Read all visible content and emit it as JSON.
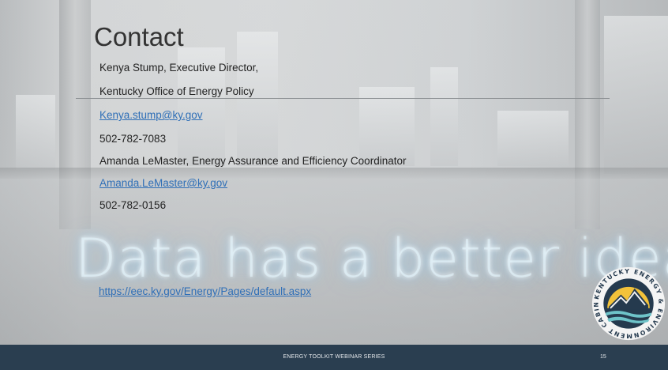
{
  "slide": {
    "title": "Contact",
    "contact_lines": [
      {
        "text": "Kenya Stump, Executive Director,",
        "link": false
      },
      {
        "text": "Kentucky Office of Energy Policy",
        "link": false
      },
      {
        "text": "Kenya.stump@ky.gov",
        "link": true
      },
      {
        "text": "502-782-7083",
        "link": false
      },
      {
        "text": "Amanda LeMaster, Energy Assurance and Efficiency Coordinator",
        "link": false
      },
      {
        "text": "Amanda.LeMaster@ky.gov",
        "link": true
      },
      {
        "text": "502-782-0156",
        "link": false
      }
    ],
    "neon_sign": "Data has a better idea",
    "website_link": "https://eec.ky.gov/Energy/Pages/default.aspx",
    "logo_text": "KENTUCKY ENERGY & ENVIRONMENT CABINET"
  },
  "footer": {
    "series_title": "ENERGY TOOLKIT WEBINAR SERIES",
    "page_number": "15"
  },
  "colors": {
    "link": "#2f6fb7",
    "footer_bg": "#2a3e50",
    "title": "#333333"
  }
}
